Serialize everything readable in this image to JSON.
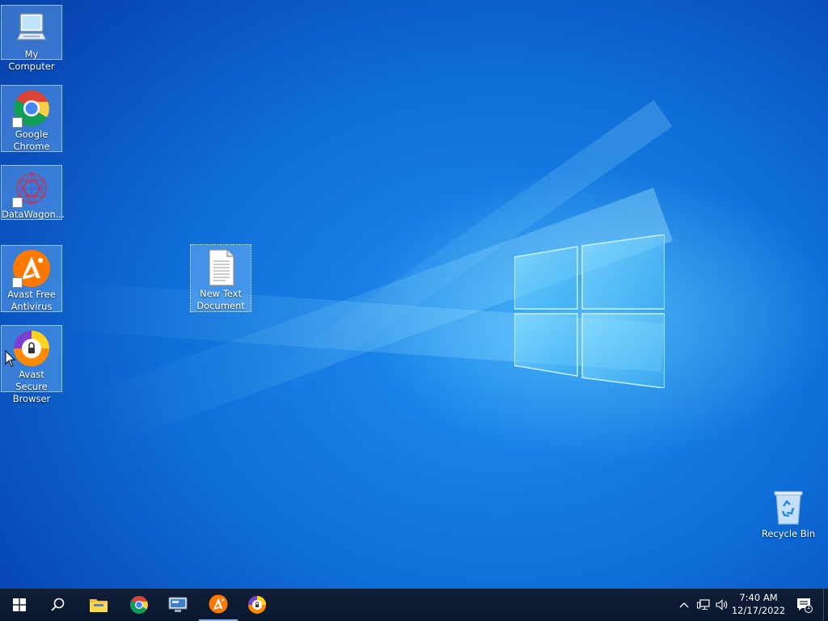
{
  "desktop": {
    "icons": [
      {
        "label": "My Computer"
      },
      {
        "label": "Google Chrome"
      },
      {
        "label": "DataWagon..."
      },
      {
        "label": "Avast Free Antivirus"
      },
      {
        "label": "Avast Secure Browser"
      },
      {
        "label": "New Text Document"
      },
      {
        "label": "Recycle Bin"
      }
    ]
  },
  "taskbar": {
    "items": [
      {
        "icon": "windows-start-icon"
      },
      {
        "icon": "search-icon"
      },
      {
        "icon": "file-explorer-icon"
      },
      {
        "icon": "chrome-icon"
      },
      {
        "icon": "datawagon-remote-icon"
      },
      {
        "icon": "avast-antivirus-icon"
      },
      {
        "icon": "avast-secure-browser-icon"
      }
    ],
    "clock": {
      "time": "7:40 AM",
      "date": "12/17/2022"
    },
    "notification_count": "1"
  },
  "colors": {
    "desktop_blue": "#0f6fd8",
    "taskbar": "#0b1a33",
    "avast_orange": "#ff7800",
    "running_indicator": "#7fb6ee"
  }
}
